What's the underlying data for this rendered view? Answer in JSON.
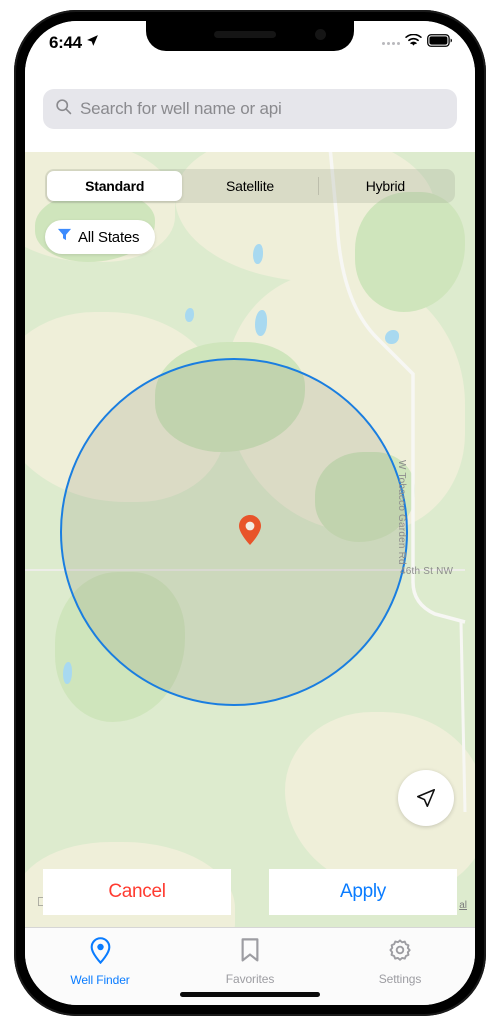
{
  "status_bar": {
    "time": "6:44",
    "location_icon": "location-arrow-icon",
    "cellular_icon": "cellular-dots-icon",
    "wifi_icon": "wifi-icon",
    "battery_icon": "battery-icon"
  },
  "search": {
    "placeholder": "Search for well name or api",
    "value": "",
    "icon": "search-icon"
  },
  "map_types": {
    "options": [
      {
        "label": "Standard",
        "selected": true
      },
      {
        "label": "Satellite",
        "selected": false
      },
      {
        "label": "Hybrid",
        "selected": false
      }
    ]
  },
  "filter": {
    "label": "All States",
    "icon": "funnel-icon"
  },
  "map": {
    "base_color": "#DDEBCE",
    "radius_circle": {
      "stroke_color": "#1A7EE0",
      "fill_color": "rgba(140,140,120,0.20)"
    },
    "center_pin_color": "#E8542A",
    "labels": [
      {
        "text": "W Tobacco Garden Rd",
        "orientation": "vertical"
      },
      {
        "text": "46th St NW",
        "orientation": "horizontal"
      }
    ],
    "attribution_logo": "apple-logo",
    "legal_link": "al",
    "locate_button_icon": "navigation-arrow-icon"
  },
  "actions": {
    "cancel_label": "Cancel",
    "cancel_color": "#FF3B30",
    "apply_label": "Apply",
    "apply_color": "#0A7CFF"
  },
  "tab_bar": {
    "items": [
      {
        "label": "Well Finder",
        "icon": "map-pin-icon",
        "active": true
      },
      {
        "label": "Favorites",
        "icon": "bookmark-icon",
        "active": false
      },
      {
        "label": "Settings",
        "icon": "gear-icon",
        "active": false
      }
    ],
    "active_color": "#0A7CFF",
    "inactive_color": "#9D9DA2"
  }
}
